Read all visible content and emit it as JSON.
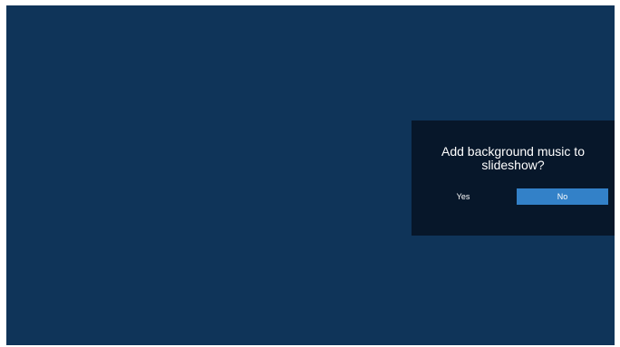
{
  "dialog": {
    "title": "Add background music to slideshow?",
    "yes_label": "Yes",
    "no_label": "No",
    "focused_button": "No"
  },
  "colors": {
    "screen_background": "#0f3459",
    "dialog_background": "#07172a",
    "focus_accent": "#3381c8",
    "text": "#ffffff"
  }
}
